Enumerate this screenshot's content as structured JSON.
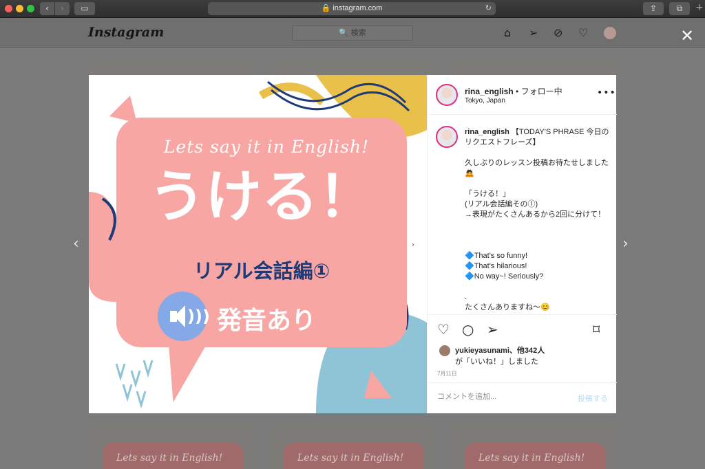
{
  "browser": {
    "url": "instagram.com",
    "lock_icon": "lock-icon"
  },
  "header": {
    "logo": "Instagram",
    "search_placeholder": "🔍 検索"
  },
  "image": {
    "script_text": "Lets say it in English!",
    "big_text": "うける！",
    "sub_text": "リアル会話編①",
    "pron_text": "発音あり"
  },
  "post": {
    "username": "rina_english",
    "follow_status": "• フォロー中",
    "location": "Tokyo, Japan",
    "caption_user": "rina_english",
    "caption_body": "【TODAY'S PHRASE 今日のリクエストフレーズ】\n\n久しぶりのレッスン投稿お待たせしました🙇\n\n「うける！」\n(リアル会話編その①)\n→表現がたくさんあるから2回に分けて！\n\n\n\n🔷That's so funny!\n🔷That's hilarious!\n🔷No way~! Seriously?\n\n.\nたくさんありますね〜😊",
    "likes_line1": "yukieyasunami、他342人",
    "likes_line2": "が「いいね！」しました",
    "date": "7月11日",
    "comment_placeholder": "コメントを追加...",
    "post_button": "投稿する"
  },
  "tiles": {
    "script_text": "Lets say it in English!"
  },
  "colors": {
    "accent_pink": "#f7a6a3",
    "navy": "#1f3a75",
    "speaker_blue": "#85a8e6",
    "post_blue": "#b2dffc"
  }
}
